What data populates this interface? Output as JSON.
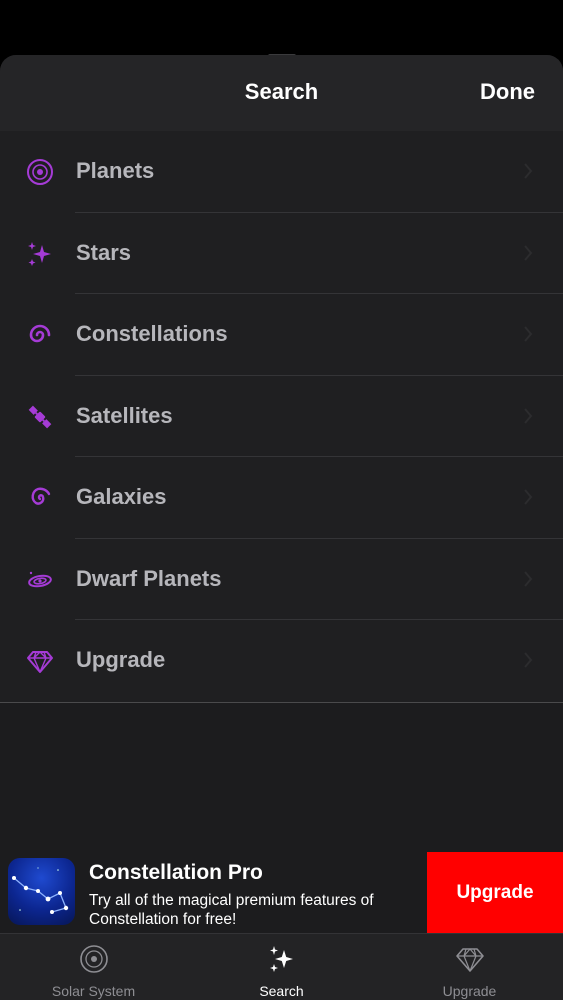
{
  "header": {
    "title": "Search",
    "done_label": "Done"
  },
  "list": {
    "items": [
      {
        "label": "Planets",
        "icon": "planet-icon"
      },
      {
        "label": "Stars",
        "icon": "sparkles-icon"
      },
      {
        "label": "Constellations",
        "icon": "spiral-icon"
      },
      {
        "label": "Satellites",
        "icon": "satellite-icon"
      },
      {
        "label": "Galaxies",
        "icon": "galaxy-icon"
      },
      {
        "label": "Dwarf Planets",
        "icon": "dwarf-planet-icon"
      },
      {
        "label": "Upgrade",
        "icon": "diamond-icon"
      }
    ]
  },
  "banner": {
    "title": "Constellation Pro",
    "subtitle": "Try all of the magical premium features of Constellation for free!",
    "button_label": "Upgrade"
  },
  "tabbar": {
    "tabs": [
      {
        "label": "Solar System",
        "icon": "planet-icon",
        "active": false
      },
      {
        "label": "Search",
        "icon": "sparkles-icon",
        "active": true
      },
      {
        "label": "Upgrade",
        "icon": "diamond-icon",
        "active": false
      }
    ]
  },
  "colors": {
    "accent": "#a53bd6",
    "upgrade_button": "#ff0000",
    "background": "#1c1c1e"
  }
}
